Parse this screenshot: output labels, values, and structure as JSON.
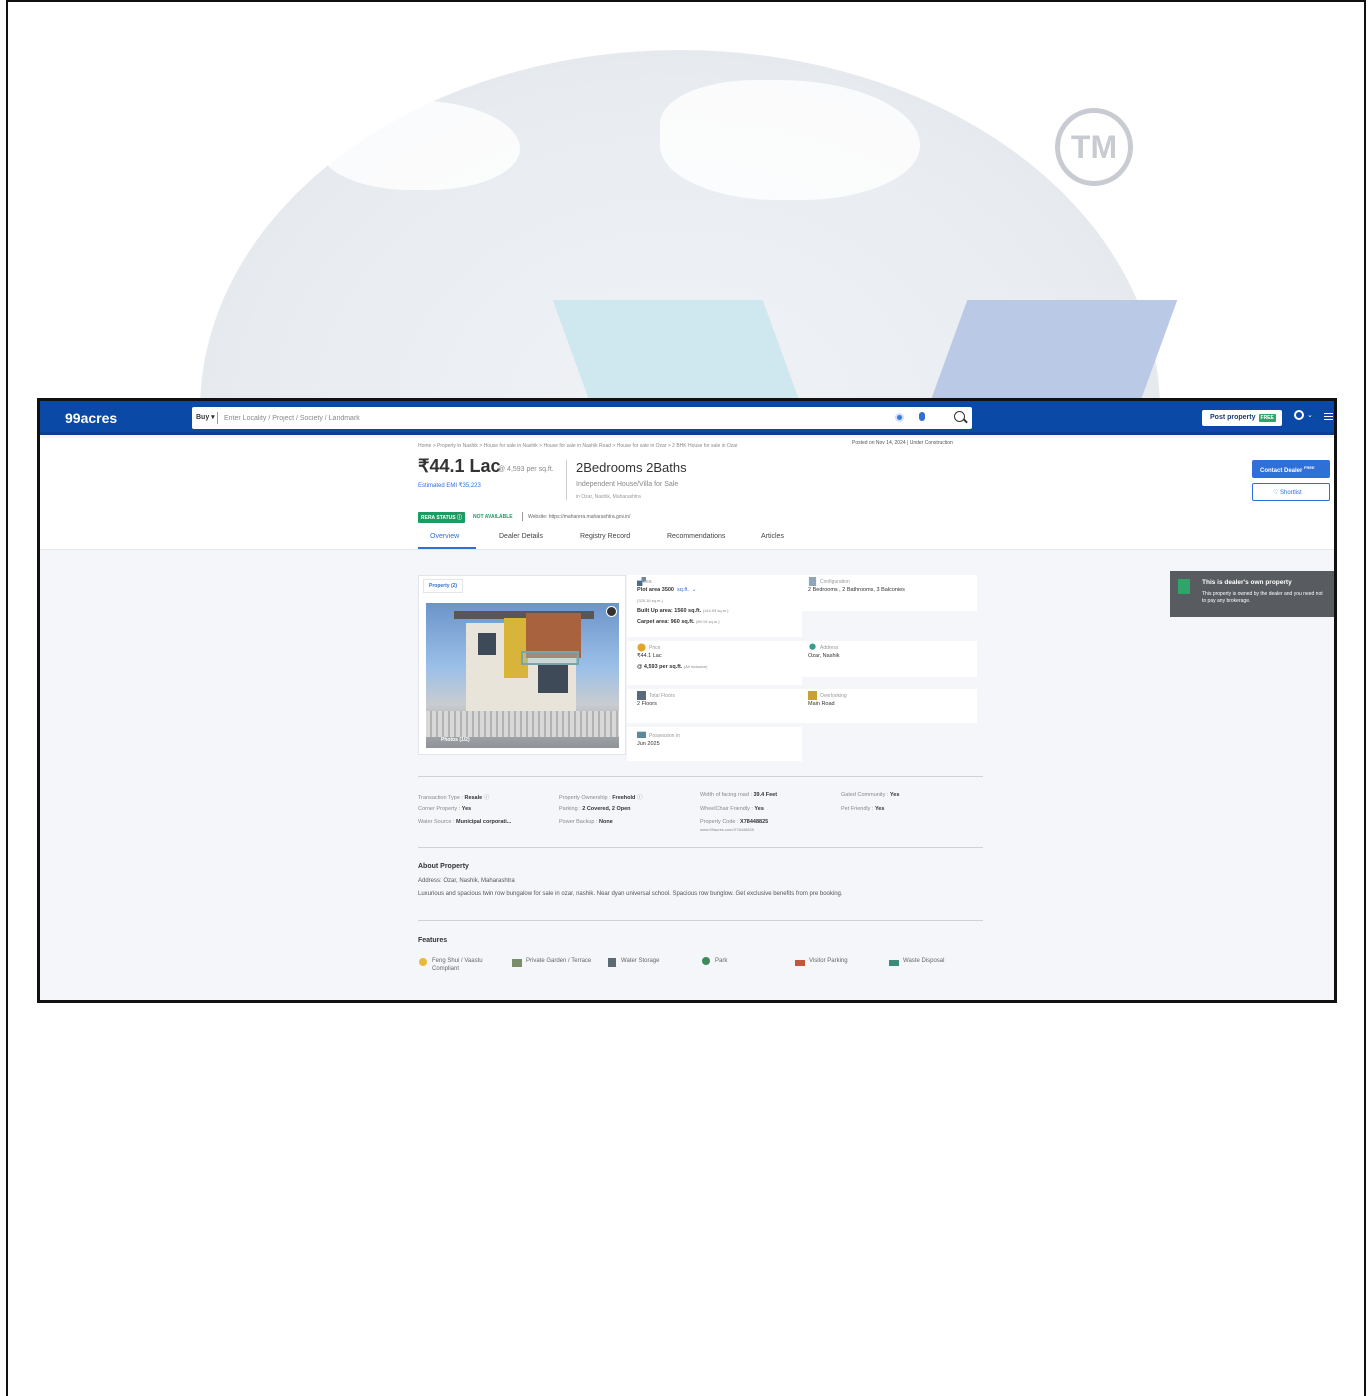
{
  "app": {
    "logo": "99acres"
  },
  "search": {
    "mode": "Buy",
    "placeholder": "Enter Locality / Project / Society / Landmark"
  },
  "header_actions": {
    "post_property": "Post property",
    "free_tag": "FREE"
  },
  "breadcrumb": "Home > Property in Nashik > House for sale in Nashik > House for sale in Nashik Road > House for sale in Ozar > 2 BHK House for sale in Ozar",
  "posted": "Posted on Nov 14, 2024  |  Under Construction",
  "price": {
    "main": "₹44.1 Lac",
    "per_sqft": "@ 4,593 per sq.ft.",
    "emi": "Estimated EMI ₹35,223"
  },
  "listing": {
    "title": "2Bedrooms 2Baths",
    "subtitle": "Independent House/Villa for Sale",
    "location": "in Ozar, Nashik, Maharashtra"
  },
  "rera": {
    "label": "RERA STATUS",
    "status": "NOT AVAILABLE",
    "website": "Website: https://maharera.maharashtra.gov.in/"
  },
  "tabs": [
    "Overview",
    "Dealer Details",
    "Registry Record",
    "Recommendations",
    "Articles"
  ],
  "cta": {
    "contact": "Contact Dealer",
    "contact_free": "FREE",
    "shortlist": "Shortlist"
  },
  "photo": {
    "tab": "Property (2)",
    "count": "Photos (1/2)"
  },
  "facts": {
    "area_label": "Area",
    "plot_area": "Plot area 3500",
    "plot_unit": "sq.ft.",
    "plot_sub": "(325.16 sq.m.)",
    "built_up": "Built Up area: 1560 sq.ft.",
    "built_up_sub": "(144.93 sq.m.)",
    "carpet": "Carpet area: 960 sq.ft.",
    "carpet_sub": "(89.19 sq.m.)",
    "config_label": "Configuration",
    "config_val": "2 Bedrooms , 2 Bathrooms, 3 Balconies",
    "price_label": "Price",
    "price_val": "₹44.1 Lac",
    "price_per": "@ 4,593 per sq.ft.",
    "price_per_sub": "(All inclusive)",
    "address_label": "Address",
    "address_val": "Ozar, Nashik",
    "floors_label": "Total Floors",
    "floors_val": "2 Floors",
    "overlooking_label": "Overlooking",
    "overlooking_val": "Main Road",
    "possession_label": "Possession in",
    "possession_val": "Jun 2025"
  },
  "dealer_note": {
    "title": "This is dealer's own property",
    "text": "This property is owned by the dealer and you need not to pay any brokerage."
  },
  "details": [
    {
      "label": "Transaction Type : ",
      "value": "Resale"
    },
    {
      "label": "Property Ownership : ",
      "value": "Freehold"
    },
    {
      "label": "Width of facing road : ",
      "value": "39.4 Feet"
    },
    {
      "label": "Gated Community : ",
      "value": "Yes"
    },
    {
      "label": "Corner Property : ",
      "value": "Yes"
    },
    {
      "label": "Parking : ",
      "value": "2 Covered, 2 Open"
    },
    {
      "label": "WheelChair Friendly : ",
      "value": "Yes"
    },
    {
      "label": "Pet Friendly : ",
      "value": "Yes"
    },
    {
      "label": "Water Source : ",
      "value": "Municipal corporati..."
    },
    {
      "label": "Power Backup : ",
      "value": "None"
    },
    {
      "label": "Property Code : ",
      "value": "X78448825"
    }
  ],
  "property_url": "www.99acres.com/X78448825",
  "about": {
    "heading": "About Property",
    "address": "Address: Ozar, Nashik, Maharashtra",
    "text": "Luxurious and spacious twin row bungalow for sale in ozar, nashik. Near dyan universal school. Spacious row bunglow. Get exclusive benefits from pre booking."
  },
  "features": {
    "heading": "Features",
    "items": [
      "Feng Shui / Vaastu Compliant",
      "Private Garden / Terrace",
      "Water Storage",
      "Park",
      "Visitor Parking",
      "Waste Disposal"
    ]
  },
  "watermark": {
    "tm": "TM"
  },
  "colors": {
    "brand_blue": "#0a4aa6",
    "accent_blue": "#2f6fd8",
    "rera_green": "#1f9a62",
    "dealer_box": "#585b60"
  }
}
